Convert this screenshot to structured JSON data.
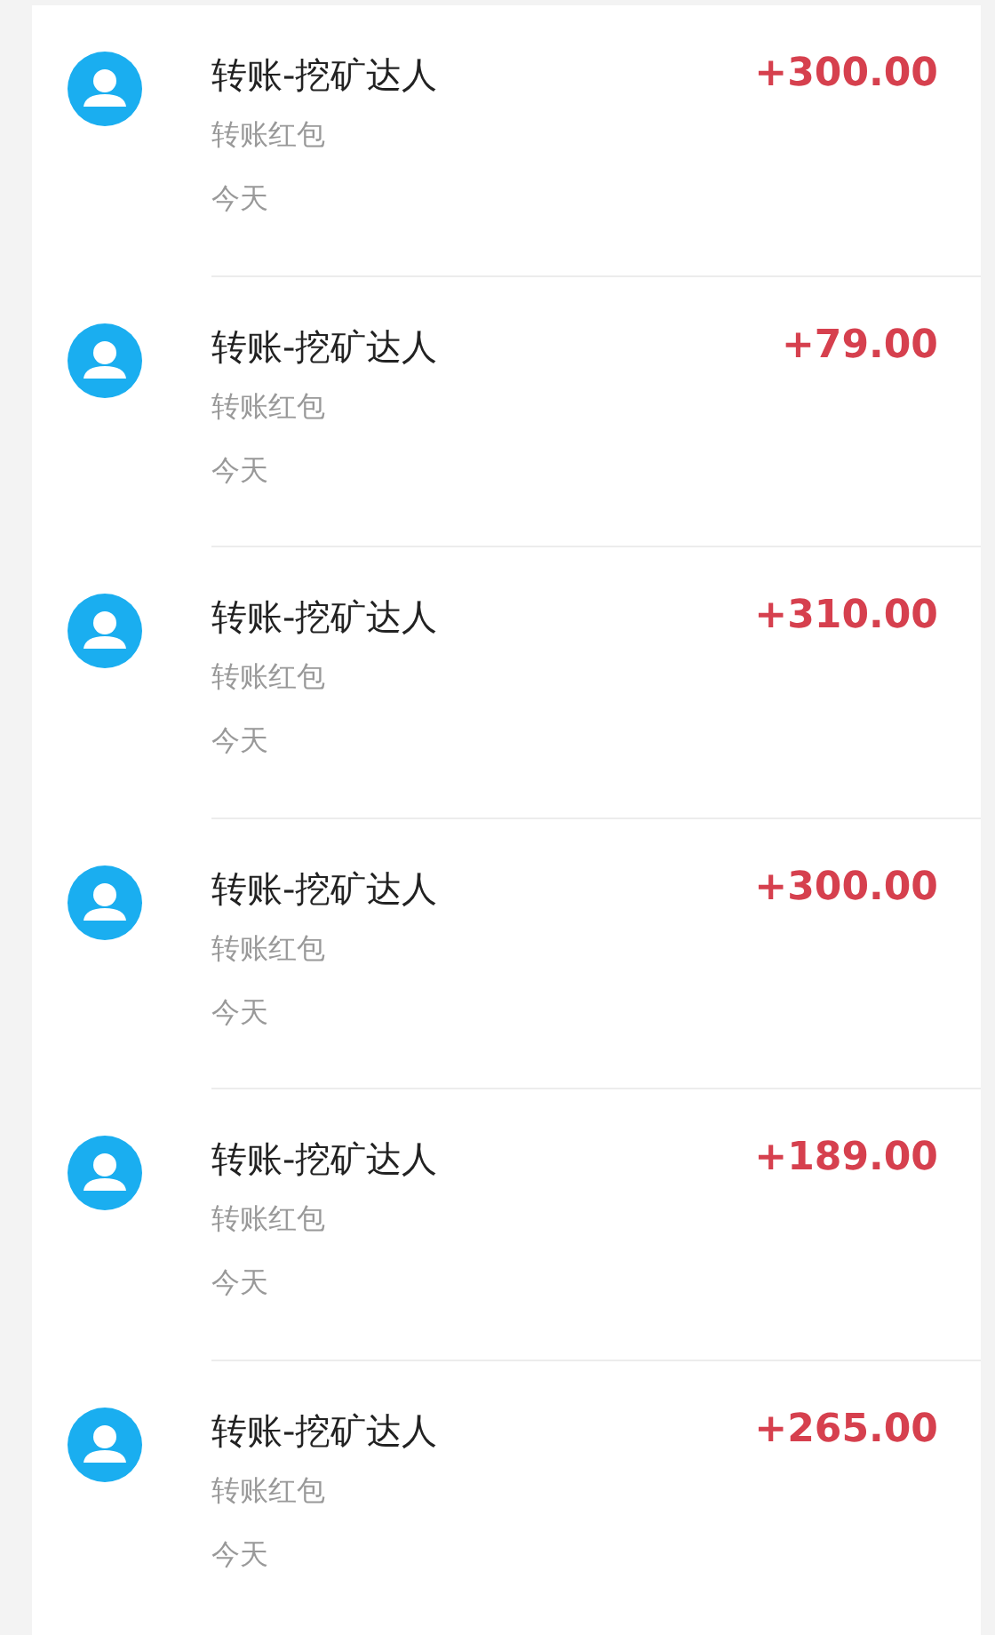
{
  "transactions": [
    {
      "title": "转账-挖矿达人",
      "subtitle": "转账红包",
      "date": "今天",
      "amount": "+300.00"
    },
    {
      "title": "转账-挖矿达人",
      "subtitle": "转账红包",
      "date": "今天",
      "amount": "+79.00"
    },
    {
      "title": "转账-挖矿达人",
      "subtitle": "转账红包",
      "date": "今天",
      "amount": "+310.00"
    },
    {
      "title": "转账-挖矿达人",
      "subtitle": "转账红包",
      "date": "今天",
      "amount": "+300.00"
    },
    {
      "title": "转账-挖矿达人",
      "subtitle": "转账红包",
      "date": "今天",
      "amount": "+189.00"
    },
    {
      "title": "转账-挖矿达人",
      "subtitle": "转账红包",
      "date": "今天",
      "amount": "+265.00"
    }
  ]
}
